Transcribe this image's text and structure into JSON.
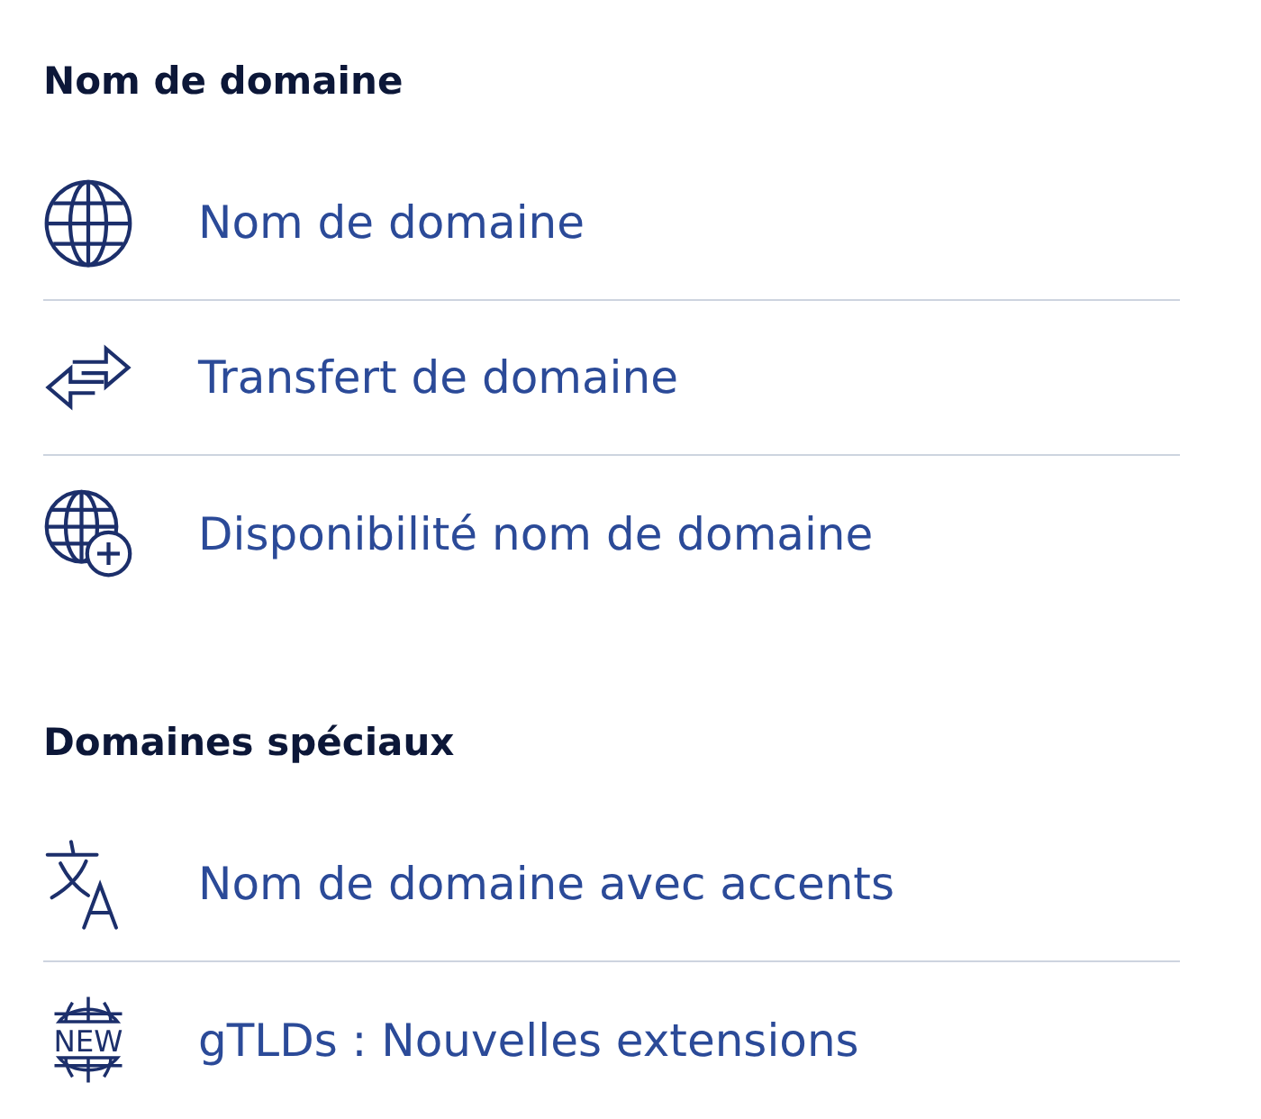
{
  "sections": [
    {
      "heading": "Nom de domaine",
      "items": [
        {
          "kind": "globe",
          "label": "Nom de domaine"
        },
        {
          "kind": "transfer",
          "label": "Transfert de domaine"
        },
        {
          "kind": "globe-plus",
          "label": "Disponibilité nom de domaine"
        }
      ]
    },
    {
      "heading": "Domaines spéciaux",
      "items": [
        {
          "kind": "translate",
          "label": "Nom de domaine avec accents"
        },
        {
          "kind": "new-globe",
          "icon_text": "NEW",
          "label": "gTLDs : Nouvelles extensions"
        }
      ]
    }
  ]
}
